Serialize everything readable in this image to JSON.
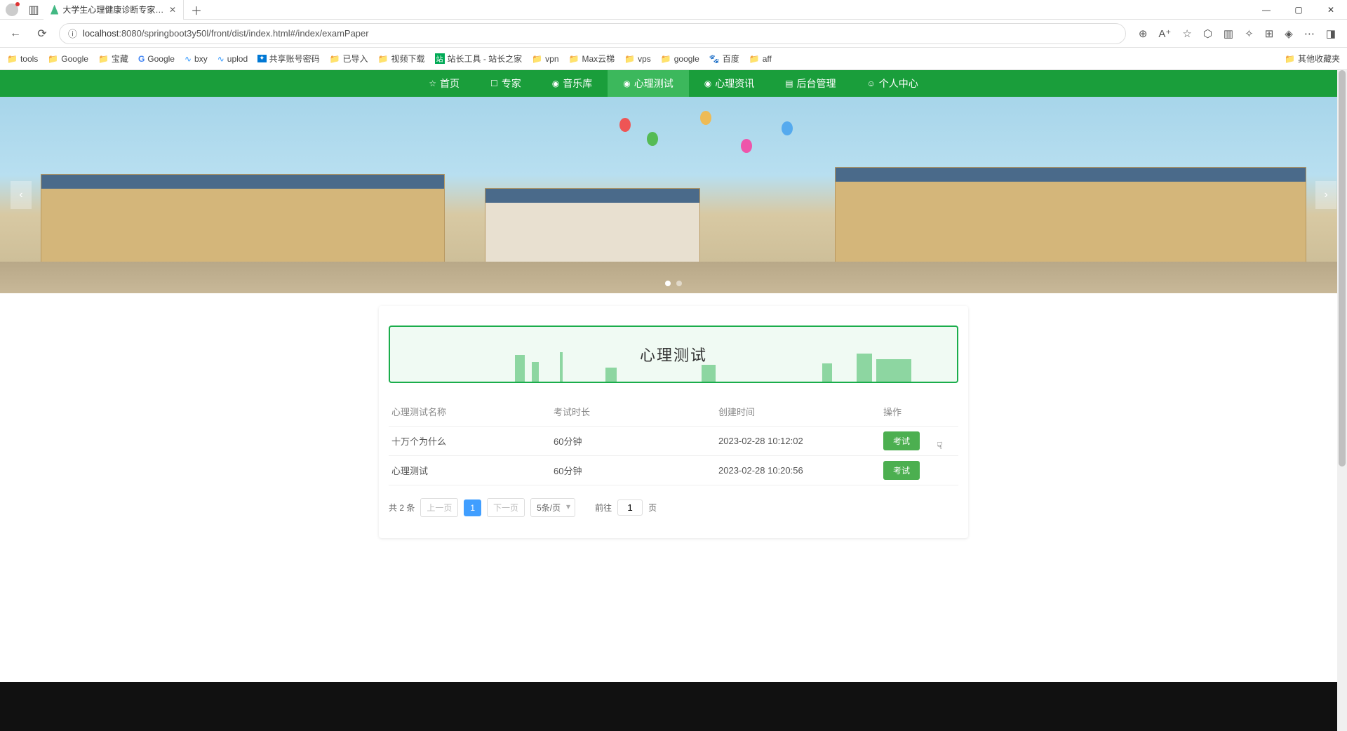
{
  "browser": {
    "tab_title": "大学生心理健康诊断专家系统设计",
    "url_host": "localhost",
    "url_path": ":8080/springboot3y50l/front/dist/index.html#/index/examPaper"
  },
  "bookmarks": [
    {
      "label": "tools",
      "type": "folder"
    },
    {
      "label": "Google",
      "type": "folder"
    },
    {
      "label": "宝藏",
      "type": "folder"
    },
    {
      "label": "Google",
      "type": "g"
    },
    {
      "label": "bxy",
      "type": "link"
    },
    {
      "label": "uplod",
      "type": "link"
    },
    {
      "label": "共享账号密码",
      "type": "ext"
    },
    {
      "label": "已导入",
      "type": "folder"
    },
    {
      "label": "视频下载",
      "type": "folder"
    },
    {
      "label": "站长工具 - 站长之家",
      "type": "ext2"
    },
    {
      "label": "vpn",
      "type": "folder"
    },
    {
      "label": "Max云梯",
      "type": "folder"
    },
    {
      "label": "vps",
      "type": "folder"
    },
    {
      "label": "google",
      "type": "folder"
    },
    {
      "label": "百度",
      "type": "baidu"
    },
    {
      "label": "aff",
      "type": "folder"
    }
  ],
  "bookmarks_overflow": "其他收藏夹",
  "nav": [
    {
      "icon": "☆",
      "label": "首页"
    },
    {
      "icon": "☐",
      "label": "专家"
    },
    {
      "icon": "◉",
      "label": "音乐库"
    },
    {
      "icon": "◉",
      "label": "心理测试",
      "active": true
    },
    {
      "icon": "◉",
      "label": "心理资讯"
    },
    {
      "icon": "▤",
      "label": "后台管理"
    },
    {
      "icon": "☺",
      "label": "个人中心"
    }
  ],
  "page_header": "心理测试",
  "table": {
    "headers": [
      "心理测试名称",
      "考试时长",
      "创建时间",
      "操作"
    ],
    "rows": [
      {
        "name": "十万个为什么",
        "duration": "60分钟",
        "created": "2023-02-28 10:12:02",
        "action": "考试"
      },
      {
        "name": "心理测试",
        "duration": "60分钟",
        "created": "2023-02-28 10:20:56",
        "action": "考试"
      }
    ]
  },
  "pagination": {
    "total_text": "共 2 条",
    "prev": "上一页",
    "page": "1",
    "next": "下一页",
    "size": "5条/页",
    "goto_prefix": "前往",
    "goto_value": "1",
    "goto_suffix": "页"
  }
}
